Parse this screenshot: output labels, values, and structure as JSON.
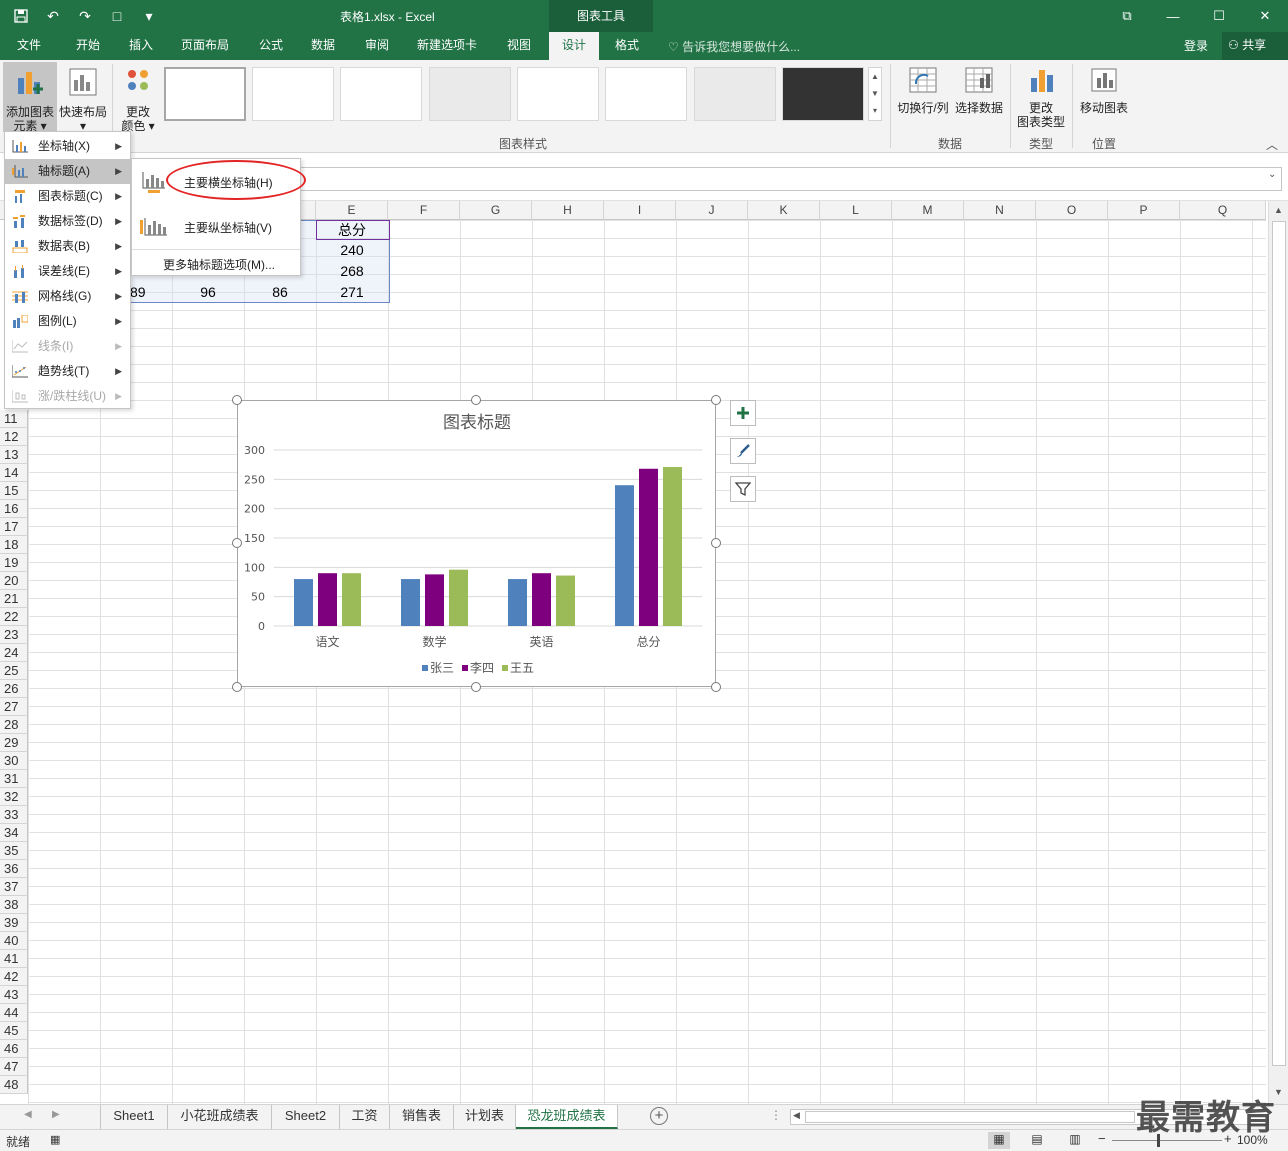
{
  "titlebar": {
    "doc_title": "表格1.xlsx - Excel",
    "tools_title": "图表工具",
    "qat_save_icon": "save-icon",
    "qat_undo": "↶",
    "qat_redo": "↷",
    "qat_new": "□",
    "qat_more": "▾",
    "win_restore": "⧉",
    "win_min": "—",
    "win_max": "☐",
    "win_close": "✕"
  },
  "tabs": [
    "文件",
    "开始",
    "插入",
    "页面布局",
    "公式",
    "数据",
    "审阅",
    "新建选项卡",
    "视图",
    "设计",
    "格式"
  ],
  "tell_me": "告诉我您想要做什么...",
  "login": "登录",
  "share": "共享",
  "ribbon": {
    "add_element": "添加图表\n元素",
    "add_element_l1": "添加图表",
    "add_element_l2": "元素 ▾",
    "quick_layout_l1": "快速布局",
    "quick_layout_l2": "▾",
    "change_color_l1": "更改",
    "change_color_l2": "颜色 ▾",
    "chart_styles_label": "图表样式",
    "switch_rowcol": "切换行/列",
    "select_data": "选择数据",
    "data_label": "数据",
    "change_type_l1": "更改",
    "change_type_l2": "图表类型",
    "type_label": "类型",
    "move_chart": "移动图表",
    "position_label": "位置"
  },
  "menu_main": [
    {
      "label": "坐标轴(X)",
      "state": "normal"
    },
    {
      "label": "轴标题(A)",
      "state": "active"
    },
    {
      "label": "图表标题(C)",
      "state": "normal"
    },
    {
      "label": "数据标签(D)",
      "state": "normal"
    },
    {
      "label": "数据表(B)",
      "state": "normal"
    },
    {
      "label": "误差线(E)",
      "state": "normal"
    },
    {
      "label": "网格线(G)",
      "state": "normal"
    },
    {
      "label": "图例(L)",
      "state": "normal"
    },
    {
      "label": "线条(I)",
      "state": "disabled"
    },
    {
      "label": "趋势线(T)",
      "state": "normal"
    },
    {
      "label": "涨/跌柱线(U)",
      "state": "disabled"
    }
  ],
  "submenu": {
    "primary_horizontal": "主要横坐标轴(H)",
    "primary_vertical": "主要纵坐标轴(V)",
    "more_options": "更多轴标题选项(M)..."
  },
  "columns": [
    "E",
    "F",
    "G",
    "H",
    "I",
    "J",
    "K",
    "L",
    "M",
    "N",
    "O",
    "P",
    "Q"
  ],
  "rows": [
    "11",
    "12",
    "13",
    "14",
    "15",
    "16",
    "17",
    "18",
    "19",
    "20",
    "21",
    "22",
    "23",
    "24",
    "25",
    "26",
    "27",
    "28",
    "29",
    "30",
    "31",
    "32",
    "33",
    "34",
    "35",
    "36",
    "37",
    "38",
    "39",
    "40",
    "41",
    "42",
    "43",
    "44",
    "45",
    "46",
    "47",
    "48"
  ],
  "cells": {
    "e1": "总分",
    "e2": "240",
    "e3": "268",
    "b4": "89",
    "c4": "96",
    "d4": "86",
    "e4": "271"
  },
  "chart_data": {
    "type": "bar",
    "title": "图表标题",
    "categories": [
      "语文",
      "数学",
      "英语",
      "总分"
    ],
    "series": [
      {
        "name": "张三",
        "values": [
          80,
          80,
          80,
          240
        ],
        "color": "#4f81bd"
      },
      {
        "name": "李四",
        "values": [
          90,
          88,
          90,
          268
        ],
        "color": "#7f007f"
      },
      {
        "name": "王五",
        "values": [
          90,
          96,
          86,
          271
        ],
        "color": "#9bbb59"
      }
    ],
    "ylim": [
      0,
      300
    ],
    "yticks": [
      "0",
      "50",
      "100",
      "150",
      "200",
      "250",
      "300"
    ],
    "grid": true,
    "legend": "bottom"
  },
  "sheets": [
    "Sheet1",
    "小花班成绩表",
    "Sheet2",
    "工资",
    "销售表",
    "计划表",
    "恐龙班成绩表"
  ],
  "active_sheet": "恐龙班成绩表",
  "status": {
    "ready": "就绪",
    "zoom": "100%"
  },
  "watermark": "最需教育"
}
